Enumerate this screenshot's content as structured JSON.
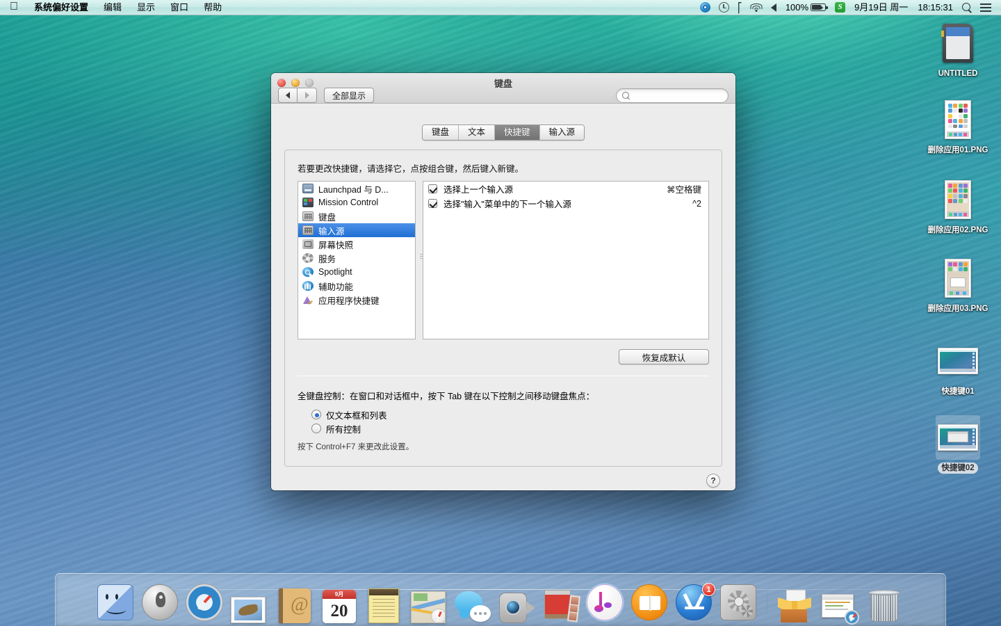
{
  "menubar": {
    "apple_icon": "apple-logo",
    "items": [
      {
        "label": "系统偏好设置",
        "bold": true
      },
      {
        "label": "编辑",
        "bold": false
      },
      {
        "label": "显示",
        "bold": false
      },
      {
        "label": "窗口",
        "bold": false
      },
      {
        "label": "帮助",
        "bold": false
      }
    ],
    "status": {
      "sync_icon": "sync-icon",
      "timemachine_icon": "time-machine-icon",
      "bluetooth_icon": "bluetooth-icon",
      "wifi_icon": "wifi-icon",
      "volume_icon": "volume-icon",
      "battery_percent": "100%",
      "battery_icon": "battery-icon",
      "input_method_icon": "S",
      "date": "9月19日 周一",
      "time": "18:15:31",
      "spotlight_icon": "spotlight-icon",
      "notification_icon": "notification-center-icon"
    }
  },
  "desktop_icons": [
    {
      "label": "UNTITLED",
      "type": "sd-card",
      "selected": false
    },
    {
      "label": "删除应用01.PNG",
      "type": "png-ios",
      "selected": false
    },
    {
      "label": "删除应用02.PNG",
      "type": "png-ios2",
      "selected": false
    },
    {
      "label": "删除应用03.PNG",
      "type": "png-ios3",
      "selected": false
    },
    {
      "label": "快捷键01",
      "type": "screenshot",
      "selected": false
    },
    {
      "label": "快捷键02",
      "type": "screenshot-win",
      "selected": true
    }
  ],
  "window": {
    "title": "键盘",
    "traffic": {
      "close": "close-button",
      "minimize": "minimize-button",
      "zoom": "zoom-button"
    },
    "toolbar": {
      "back_icon": "back-arrow-icon",
      "forward_icon": "forward-arrow-icon",
      "show_all_label": "全部显示",
      "search_placeholder": "",
      "search_value": "",
      "search_icon": "search-icon"
    },
    "tabs": [
      {
        "label": "键盘",
        "active": false
      },
      {
        "label": "文本",
        "active": false
      },
      {
        "label": "快捷键",
        "active": true
      },
      {
        "label": "输入源",
        "active": false
      }
    ],
    "hint": "若要更改快捷键，请选择它，点按组合键，然后键入新键。",
    "categories": [
      {
        "label": "Launchpad 与 D...",
        "icon": "launchpad-dock-icon",
        "selected": false
      },
      {
        "label": "Mission Control",
        "icon": "mission-control-icon",
        "selected": false
      },
      {
        "label": "键盘",
        "icon": "keyboard-icon",
        "selected": false
      },
      {
        "label": "输入源",
        "icon": "input-source-icon",
        "selected": true
      },
      {
        "label": "屏幕快照",
        "icon": "screenshot-icon",
        "selected": false
      },
      {
        "label": "服务",
        "icon": "services-icon",
        "selected": false
      },
      {
        "label": "Spotlight",
        "icon": "spotlight-icon",
        "selected": false
      },
      {
        "label": "辅助功能",
        "icon": "accessibility-icon",
        "selected": false
      },
      {
        "label": "应用程序快捷键",
        "icon": "app-shortcuts-icon",
        "selected": false
      }
    ],
    "shortcuts": [
      {
        "checked": true,
        "name": "选择上一个输入源",
        "key": "⌘空格键"
      },
      {
        "checked": true,
        "name": "选择\"输入\"菜单中的下一个输入源",
        "key": "^2"
      }
    ],
    "restore_defaults_label": "恢复成默认",
    "full_keyboard_access": {
      "title": "全键盘控制：在窗口和对话框中，按下 Tab 键在以下控制之间移动键盘焦点：",
      "options": [
        {
          "label": "仅文本框和列表",
          "selected": true
        },
        {
          "label": "所有控制",
          "selected": false
        }
      ],
      "footnote": "按下 Control+F7 来更改此设置。"
    },
    "help_label": "?"
  },
  "dock": {
    "items": [
      {
        "name": "Finder",
        "icon": "finder-icon",
        "badge": ""
      },
      {
        "name": "Launchpad",
        "icon": "launchpad-icon",
        "badge": ""
      },
      {
        "name": "Safari",
        "icon": "safari-icon",
        "badge": ""
      },
      {
        "name": "Mail",
        "icon": "mail-icon",
        "badge": ""
      },
      {
        "name": "Contacts",
        "icon": "contacts-icon",
        "badge": ""
      },
      {
        "name": "Calendar",
        "icon": "calendar-icon",
        "badge": "",
        "month": "9月",
        "day": "20"
      },
      {
        "name": "Notes",
        "icon": "notes-icon",
        "badge": ""
      },
      {
        "name": "Maps",
        "icon": "maps-icon",
        "badge": ""
      },
      {
        "name": "Messages",
        "icon": "messages-icon",
        "badge": ""
      },
      {
        "name": "FaceTime",
        "icon": "facetime-icon",
        "badge": ""
      },
      {
        "name": "Photo Booth",
        "icon": "photo-booth-icon",
        "badge": ""
      },
      {
        "name": "iTunes",
        "icon": "itunes-icon",
        "badge": ""
      },
      {
        "name": "iBooks",
        "icon": "ibooks-icon",
        "badge": ""
      },
      {
        "name": "App Store",
        "icon": "app-store-icon",
        "badge": "1"
      },
      {
        "name": "System Preferences",
        "icon": "system-preferences-icon",
        "badge": ""
      },
      {
        "name": "Downloads",
        "icon": "downloads-stack-icon",
        "badge": ""
      },
      {
        "name": "Documents",
        "icon": "documents-stack-icon",
        "badge": ""
      },
      {
        "name": "Trash",
        "icon": "trash-icon",
        "badge": ""
      }
    ]
  },
  "colors": {
    "selection_blue": "#1f6fd4",
    "active_tab_gray": "#727272",
    "badge_red": "#e03225",
    "desktop_teal": "#1fae9b",
    "desktop_blue": "#4a7fb0"
  }
}
